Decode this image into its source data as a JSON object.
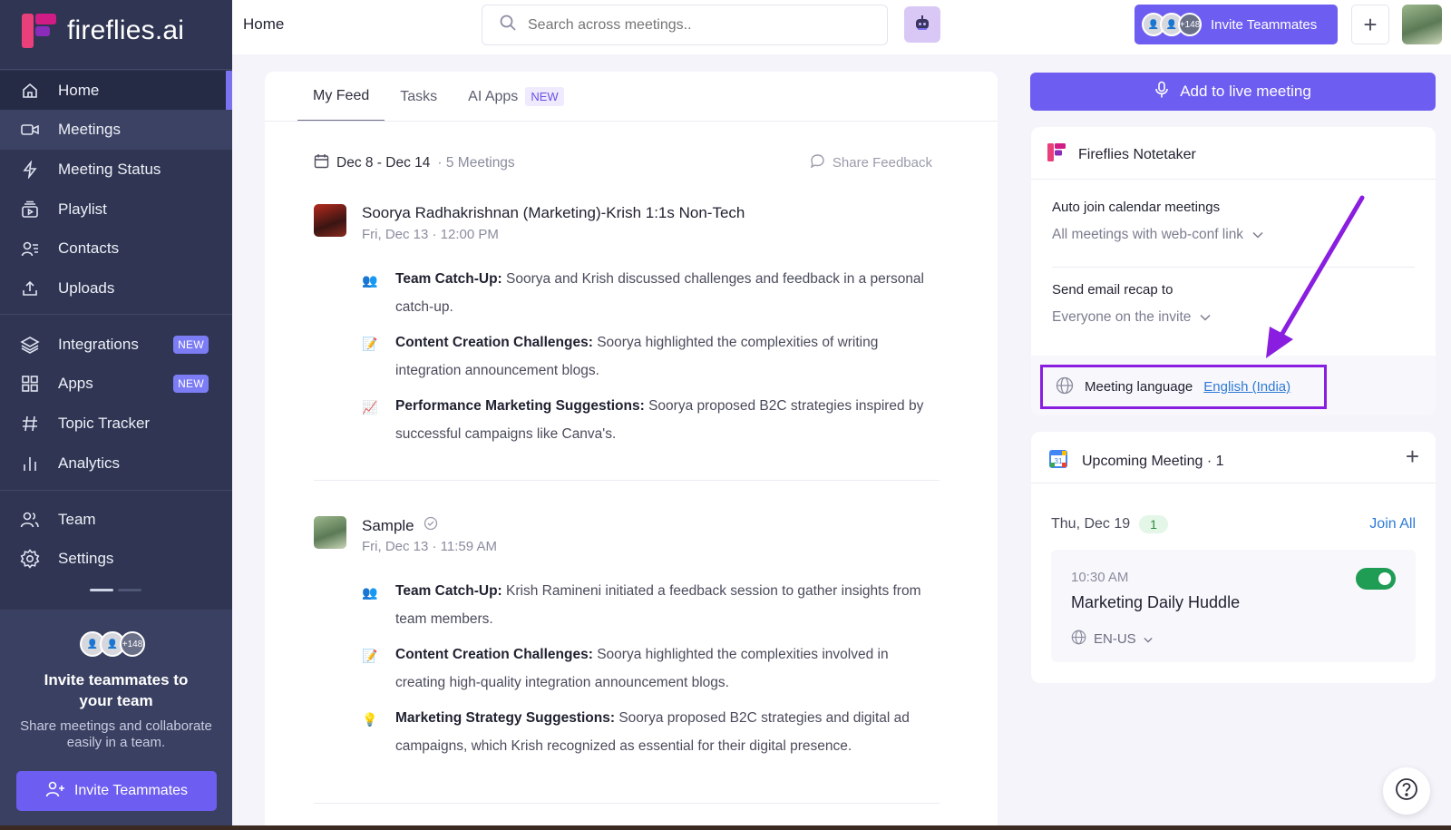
{
  "app": {
    "logo_text": "fireflies.ai"
  },
  "sidebar": {
    "items": [
      {
        "label": "Home"
      },
      {
        "label": "Meetings"
      },
      {
        "label": "Meeting Status"
      },
      {
        "label": "Playlist"
      },
      {
        "label": "Contacts"
      },
      {
        "label": "Uploads"
      },
      {
        "label": "Integrations",
        "badge": "NEW"
      },
      {
        "label": "Apps",
        "badge": "NEW"
      },
      {
        "label": "Topic Tracker"
      },
      {
        "label": "Analytics"
      },
      {
        "label": "Team"
      },
      {
        "label": "Settings"
      }
    ],
    "invite": {
      "more_count": "+148",
      "title": "Invite teammates to your team",
      "subtitle": "Share meetings and collaborate easily in a team.",
      "button": "Invite Teammates"
    }
  },
  "topbar": {
    "title": "Home",
    "search_placeholder": "Search across meetings..",
    "invite_count": "+148",
    "invite_label": "Invite Teammates",
    "plus": "+"
  },
  "feed": {
    "tabs": [
      {
        "label": "My Feed"
      },
      {
        "label": "Tasks"
      },
      {
        "label": "AI Apps",
        "badge": "NEW"
      }
    ],
    "date_range": "Dec 8 - Dec 14",
    "meeting_count": "· 5 Meetings",
    "share_feedback": "Share Feedback",
    "meetings": [
      {
        "title": "Soorya Radhakrishnan (Marketing)-Krish 1:1s Non-Tech",
        "time": "Fri, Dec 13 · 12:00 PM",
        "bullets": [
          {
            "emoji": "👥",
            "head": "Team Catch-Up:",
            "text": " Soorya and Krish discussed challenges and feedback in a personal catch-up."
          },
          {
            "emoji": "📝",
            "head": "Content Creation Challenges:",
            "text": " Soorya highlighted the complexities of writing integration announcement blogs."
          },
          {
            "emoji": "📈",
            "head": "Performance Marketing Suggestions:",
            "text": " Soorya proposed B2C strategies inspired by successful campaigns like Canva's."
          }
        ]
      },
      {
        "title": "Sample",
        "time": "Fri, Dec 13 · 11:59 AM",
        "bullets": [
          {
            "emoji": "👥",
            "head": "Team Catch-Up:",
            "text": " Krish Ramineni initiated a feedback session to gather insights from team members."
          },
          {
            "emoji": "📝",
            "head": "Content Creation Challenges:",
            "text": " Soorya highlighted the complexities involved in creating high-quality integration announcement blogs."
          },
          {
            "emoji": "💡",
            "head": "Marketing Strategy Suggestions:",
            "text": " Soorya proposed B2C strategies and digital ad campaigns, which Krish recognized as essential for their digital presence."
          }
        ]
      }
    ]
  },
  "right": {
    "add_live": "Add to live meeting",
    "notetaker": {
      "title": "Fireflies Notetaker",
      "auto_join_label": "Auto join calendar meetings",
      "auto_join_value": "All meetings with web-conf link",
      "email_recap_label": "Send email recap to",
      "email_recap_value": "Everyone on the invite",
      "language_label": "Meeting language",
      "language_value": "English (India)"
    },
    "upcoming": {
      "title": "Upcoming Meeting · 1",
      "date": "Thu, Dec 19",
      "count": "1",
      "join_all": "Join All",
      "meeting_time": "10:30 AM",
      "meeting_title": "Marketing Daily Huddle",
      "meeting_lang": "EN-US",
      "record_enabled": true
    }
  },
  "colors": {
    "accent": "#6d5df0",
    "sidebar": "#2f3552",
    "highlight": "#8a1ee0",
    "link": "#2e7bd6"
  }
}
